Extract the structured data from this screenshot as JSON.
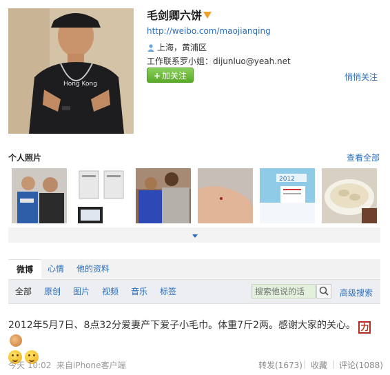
{
  "profile": {
    "name": "毛剑卿六饼",
    "url": "http://weibo.com/maojianqing",
    "location": "上海，黄浦区",
    "contact": "工作联系罗小姐：dijunluo@yeah.net",
    "follow_button": "加关注",
    "quiet_follow": "悄悄关注"
  },
  "photos": {
    "title": "个人照片",
    "view_all": "查看全部"
  },
  "tabs": [
    {
      "label": "微博",
      "active": true
    },
    {
      "label": "心情",
      "active": false
    },
    {
      "label": "他的资料",
      "active": false
    }
  ],
  "subnav": {
    "items": [
      "全部",
      "原创",
      "图片",
      "视频",
      "音乐",
      "标签"
    ],
    "search_placeholder": "搜索他说的话",
    "advanced_search": "高级搜索"
  },
  "post": {
    "text": "2012年5月7日、8点32分爱妻产下爱子小毛巾。体重7斤2两。感谢大家的关心。",
    "stamp_char": "力",
    "time": "今天 10:02",
    "source": "来自iPhone客户端",
    "repost": "转发(1673)",
    "favorite": "收藏",
    "comment": "评论(1088)",
    "separator": "|"
  },
  "colors": {
    "link": "#2a6ebb",
    "follow_green": "#5aa927"
  }
}
